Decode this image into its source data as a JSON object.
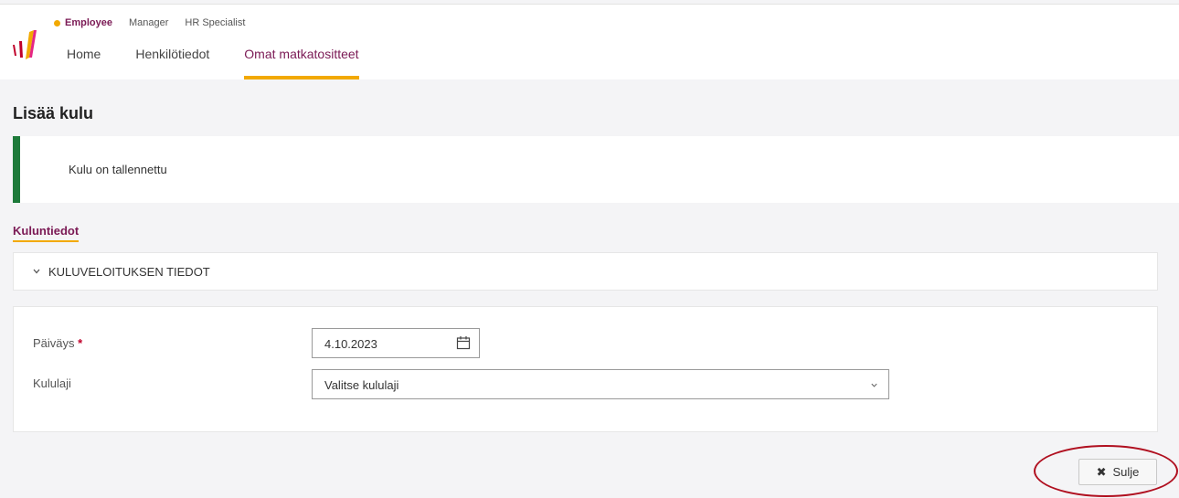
{
  "header": {
    "roles": [
      {
        "label": "Employee",
        "active": true
      },
      {
        "label": "Manager",
        "active": false
      },
      {
        "label": "HR Specialist",
        "active": false
      }
    ],
    "nav": [
      {
        "label": "Home",
        "active": false
      },
      {
        "label": "Henkilötiedot",
        "active": false
      },
      {
        "label": "Omat matkatositteet",
        "active": true
      }
    ]
  },
  "page": {
    "title": "Lisää kulu",
    "alert": "Kulu on tallennettu",
    "section_title": "Kuluntiedot",
    "panel_title": "KULUVELOITUKSEN TIEDOT"
  },
  "form": {
    "date_label": "Päiväys",
    "date_required_mark": "*",
    "date_value": "4.10.2023",
    "type_label": "Kululaji",
    "type_value": "Valitse kululaji"
  },
  "actions": {
    "close_label": "Sulje",
    "close_icon": "✖"
  },
  "colors": {
    "accent": "#7b1a55",
    "highlight": "#f2a900",
    "success": "#1d7a3a"
  }
}
